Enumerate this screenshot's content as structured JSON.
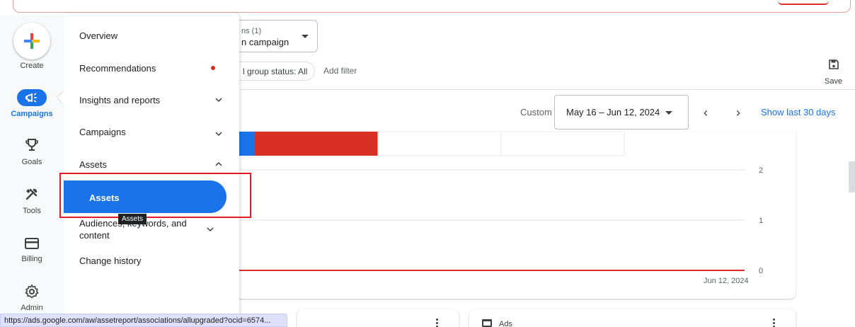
{
  "rail": {
    "create_label": "Create",
    "items": [
      {
        "label": "Campaigns",
        "icon": "megaphone-icon",
        "active": true
      },
      {
        "label": "Goals",
        "icon": "trophy-icon"
      },
      {
        "label": "Tools",
        "icon": "tools-icon"
      },
      {
        "label": "Billing",
        "icon": "credit-card-icon"
      },
      {
        "label": "Admin",
        "icon": "gear-icon"
      }
    ]
  },
  "drawer": {
    "items": [
      {
        "label": "Overview"
      },
      {
        "label": "Recommendations",
        "badge": "red-dot"
      },
      {
        "label": "Insights and reports",
        "chevron": "down"
      },
      {
        "label": "Campaigns",
        "chevron": "down"
      },
      {
        "label": "Assets",
        "chevron": "up"
      },
      {
        "label": "Audiences, keywords, and content",
        "chevron": "down"
      },
      {
        "label": "Change history"
      }
    ],
    "active_sub_item": "Assets",
    "tooltip": "Assets"
  },
  "filters": {
    "campaign_small": "ns (1)",
    "campaign_main": "n campaign",
    "chip": "l group status: All",
    "add_filter": "Add filter"
  },
  "toolbar": {
    "save_label": "Save"
  },
  "date": {
    "custom_label": "Custom",
    "range": "May 16 – Jun 12, 2024",
    "show_last": "Show last 30 days"
  },
  "chart_data": {
    "type": "line",
    "x": [
      "Jun 12, 2024"
    ],
    "series": [
      {
        "values": [
          0
        ]
      }
    ],
    "yticks": [
      "2",
      "1",
      "0"
    ],
    "xtick": "Jun 12, 2024",
    "ylim": [
      0,
      2
    ],
    "grid": true,
    "colors": {
      "series": "#d93025",
      "segment_blue": "#1a73e8",
      "segment_red": "#d93025"
    }
  },
  "bottom": {
    "ads_label": "Ads"
  },
  "status_url": "https://ads.google.com/aw/assetreport/associations/allupgraded?ocid=6574..."
}
